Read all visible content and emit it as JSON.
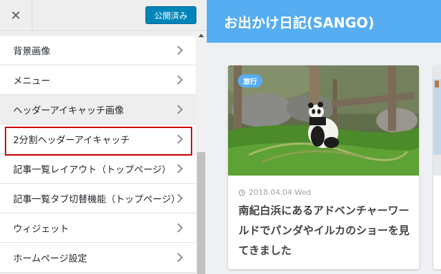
{
  "sidebar": {
    "close_glyph": "✕",
    "publish_label": "公開済み",
    "items": [
      {
        "label": "背景画像"
      },
      {
        "label": "メニュー"
      },
      {
        "label": "ヘッダーアイキャッチ画像"
      },
      {
        "label": "2分割ヘッダーアイキャッチ"
      },
      {
        "label": "記事一覧レイアウト（トップページ）"
      },
      {
        "label": "記事一覧タブ切替機能（トップページ）"
      },
      {
        "label": "ウィジェット"
      },
      {
        "label": "ホームページ設定"
      }
    ],
    "highlight_color": "#cc0000"
  },
  "preview": {
    "site_title": "お出かけ日記(SANGO)",
    "header_color": "#56adf1",
    "card": {
      "tag": "旅行",
      "date": "2018.04.04 Wed",
      "title": "南紀白浜にあるアドベンチャーワールドでパンダやイルカのショーを見てきました",
      "image": "panda-photo"
    }
  }
}
